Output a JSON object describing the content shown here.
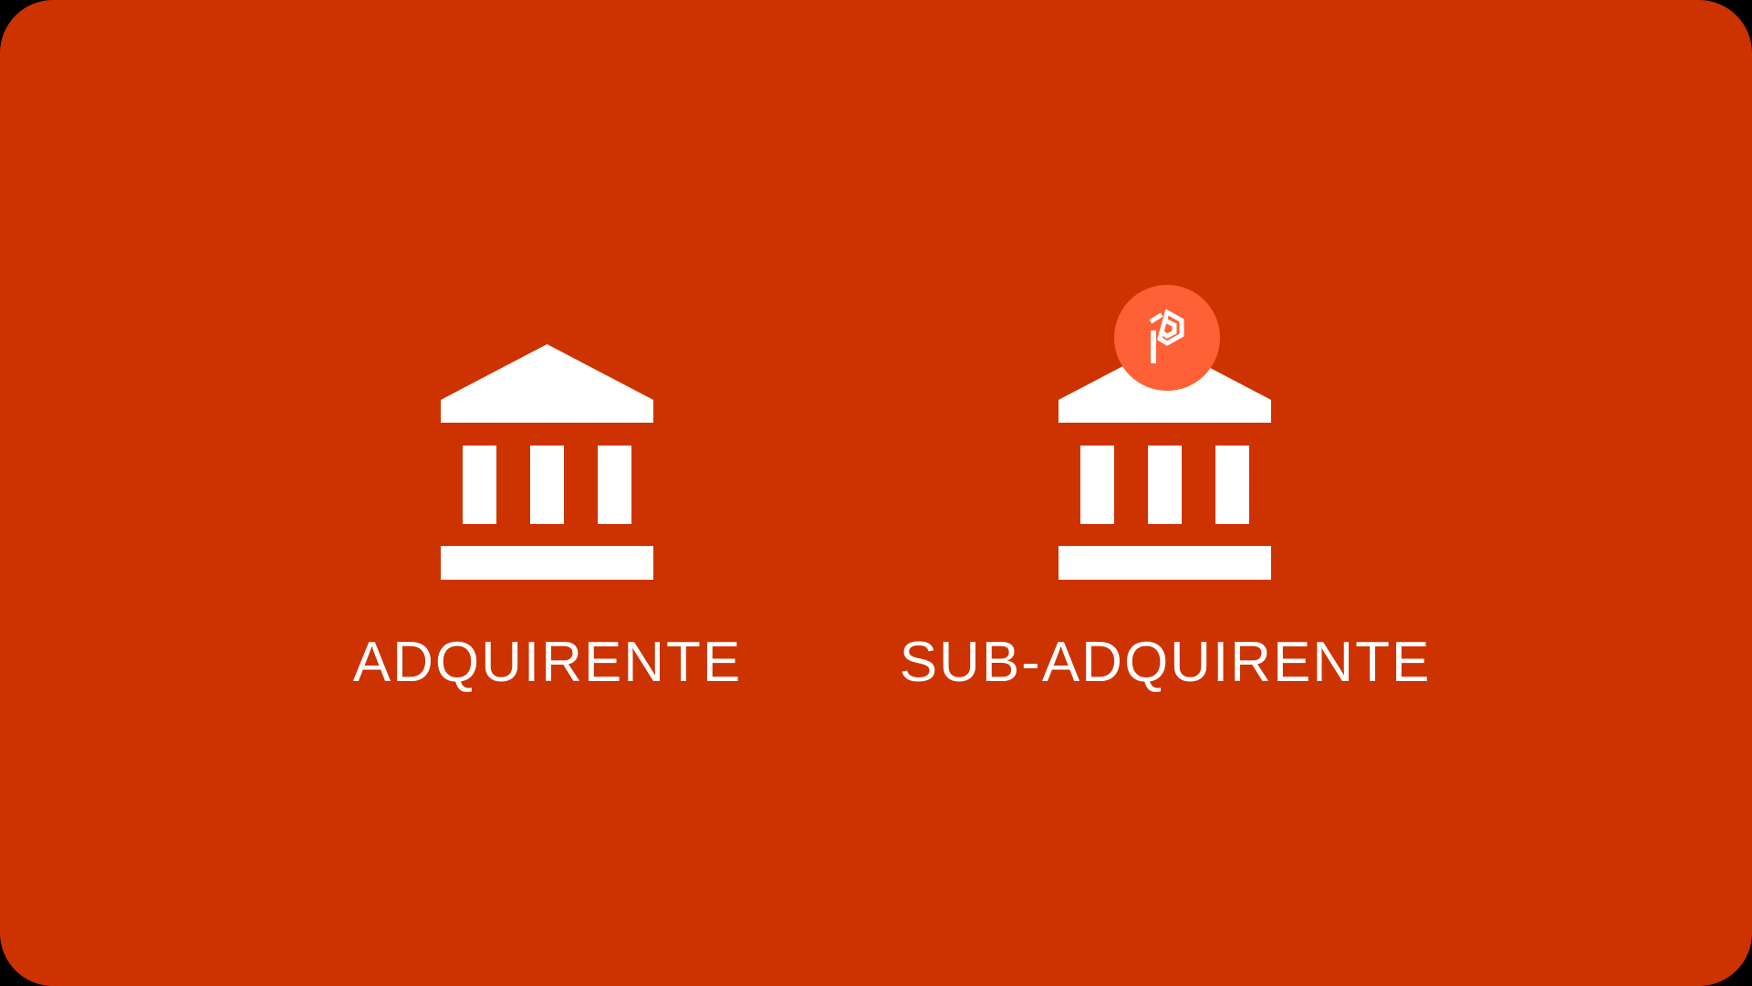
{
  "colors": {
    "background": "#CC3300",
    "foreground": "#FFFFFF",
    "badge": "#FF6035",
    "outer": "#000000"
  },
  "items": [
    {
      "label": "ADQUIRENTE",
      "icon": "bank-icon",
      "badge": false
    },
    {
      "label": "SUB-ADQUIRENTE",
      "icon": "bank-icon",
      "badge": true,
      "badge_icon": "brand-logo-icon"
    }
  ]
}
